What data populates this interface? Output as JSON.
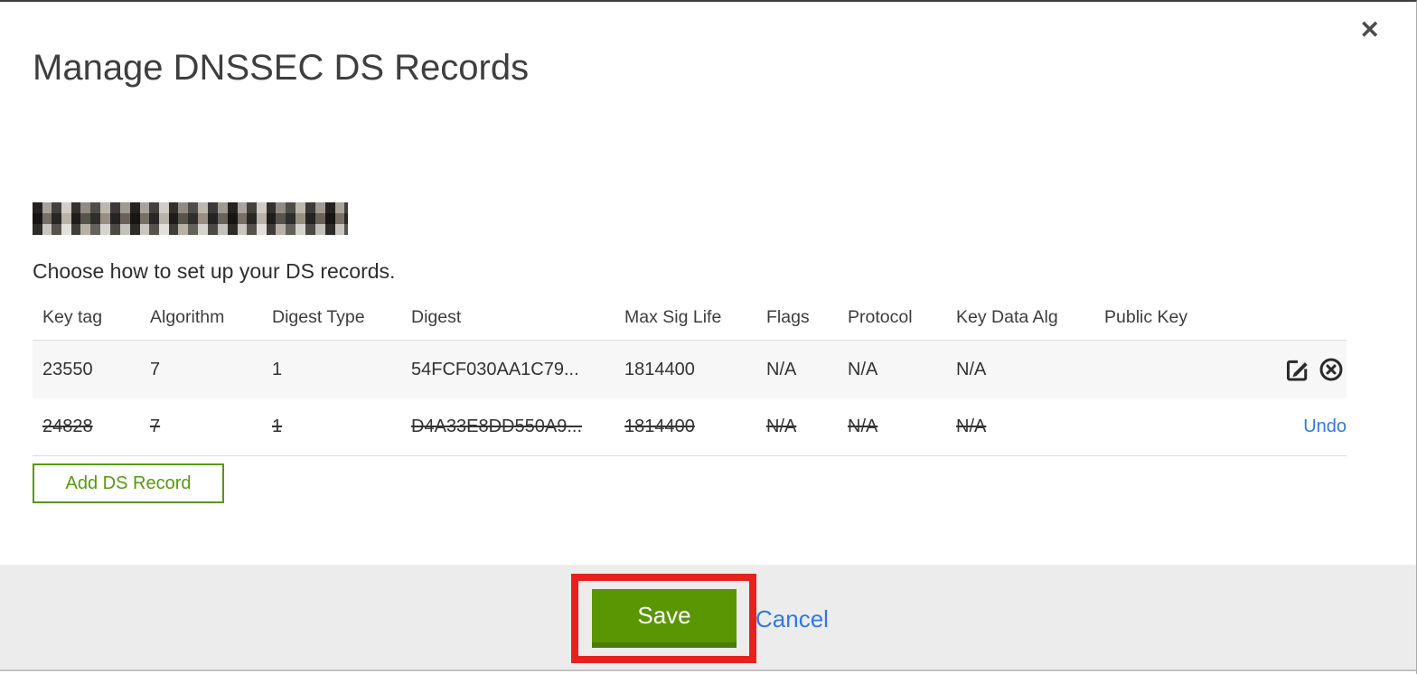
{
  "window": {
    "title": "Manage DNSSEC DS Records",
    "close_icon": "✕"
  },
  "domain_label": {
    "redacted": true
  },
  "instruction": "Choose how to set up your DS records.",
  "table": {
    "headers": [
      "Key tag",
      "Algorithm",
      "Digest Type",
      "Digest",
      "Max Sig Life",
      "Flags",
      "Protocol",
      "Key Data Alg",
      "Public Key"
    ],
    "rows": [
      {
        "key_tag": "23550",
        "algorithm": "7",
        "digest_type": "1",
        "digest": "54FCF030AA1C79...",
        "max_sig_life": "1814400",
        "flags": "N/A",
        "protocol": "N/A",
        "key_data_alg": "N/A",
        "public_key": "",
        "status": "active"
      },
      {
        "key_tag": "24828",
        "algorithm": "7",
        "digest_type": "1",
        "digest": "D4A33E8DD550A9...",
        "max_sig_life": "1814400",
        "flags": "N/A",
        "protocol": "N/A",
        "key_data_alg": "N/A",
        "public_key": "",
        "status": "marked-for-deletion",
        "action_label": "Undo"
      }
    ]
  },
  "buttons": {
    "add_record": "Add DS Record",
    "save": "Save",
    "cancel": "Cancel"
  },
  "colors": {
    "accent_green": "#58990f",
    "save_green": "#5a9604",
    "save_green_dark": "#4a7d03",
    "link_blue": "#3278e4",
    "annotation_red": "#e8211c",
    "footer_gray": "#ececec",
    "row_stripe": "#f7f7f7"
  }
}
